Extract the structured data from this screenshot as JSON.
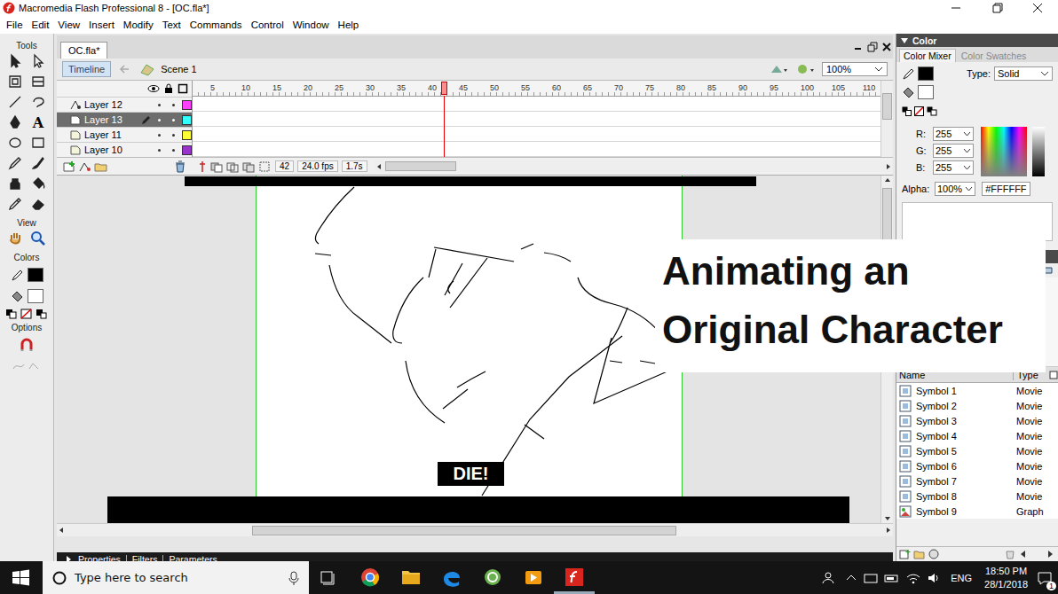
{
  "window": {
    "title": "Macromedia Flash Professional 8 - [OC.fla*]"
  },
  "menu": [
    "File",
    "Edit",
    "View",
    "Insert",
    "Modify",
    "Text",
    "Commands",
    "Control",
    "Window",
    "Help"
  ],
  "tools": {
    "title": "Tools",
    "text_glyph": "A",
    "view_label": "View",
    "colors_label": "Colors",
    "options_label": "Options"
  },
  "document": {
    "tab": "OC.fla*",
    "timeline_button": "Timeline",
    "scene": "Scene 1",
    "zoom": "100%"
  },
  "timeline": {
    "ruler": [
      "5",
      "10",
      "15",
      "20",
      "25",
      "30",
      "35",
      "40",
      "45",
      "50",
      "55",
      "60",
      "65",
      "70",
      "75",
      "80",
      "85",
      "90",
      "95",
      "100",
      "105",
      "110"
    ],
    "layers": [
      {
        "name": "Layer 12",
        "kind": "guide",
        "selected": false,
        "color": "#ff40ff"
      },
      {
        "name": "Layer 13",
        "kind": "normal",
        "selected": true,
        "color": "#33ffff"
      },
      {
        "name": "Layer 11",
        "kind": "normal",
        "selected": false,
        "color": "#ffff33"
      },
      {
        "name": "Layer 10",
        "kind": "normal",
        "selected": false,
        "color": "#9933cc"
      }
    ],
    "current_frame": "42",
    "fps": "24.0 fps",
    "elapsed": "1.7s"
  },
  "stage": {
    "caption": "DIE!"
  },
  "overlay": {
    "lines": [
      "Animating an",
      "Original Character"
    ]
  },
  "properties_bar": [
    "Properties",
    "Filters",
    "Parameters"
  ],
  "color_panel": {
    "title": "Color",
    "tabs": [
      {
        "label": "Color Mixer",
        "selected": true
      },
      {
        "label": "Color Swatches",
        "selected": false
      }
    ],
    "type_label": "Type:",
    "type": "Solid",
    "channels": [
      {
        "label": "R:",
        "value": "255"
      },
      {
        "label": "G:",
        "value": "255"
      },
      {
        "label": "B:",
        "value": "255"
      }
    ],
    "alpha_label": "Alpha:",
    "alpha": "100%",
    "hex": "#FFFFFF"
  },
  "library": {
    "columns": [
      "Name",
      "Type"
    ],
    "rows": [
      {
        "name": "Symbol 1",
        "type": "Movie"
      },
      {
        "name": "Symbol 2",
        "type": "Movie"
      },
      {
        "name": "Symbol 3",
        "type": "Movie"
      },
      {
        "name": "Symbol 4",
        "type": "Movie"
      },
      {
        "name": "Symbol 5",
        "type": "Movie"
      },
      {
        "name": "Symbol 6",
        "type": "Movie"
      },
      {
        "name": "Symbol 7",
        "type": "Movie"
      },
      {
        "name": "Symbol 8",
        "type": "Movie"
      },
      {
        "name": "Symbol 9",
        "type": "Graph"
      }
    ]
  },
  "taskbar": {
    "search_placeholder": "Type here to search",
    "language": "ENG",
    "time": "18:50 PM",
    "date": "28/1/2018",
    "notifications": "1"
  }
}
